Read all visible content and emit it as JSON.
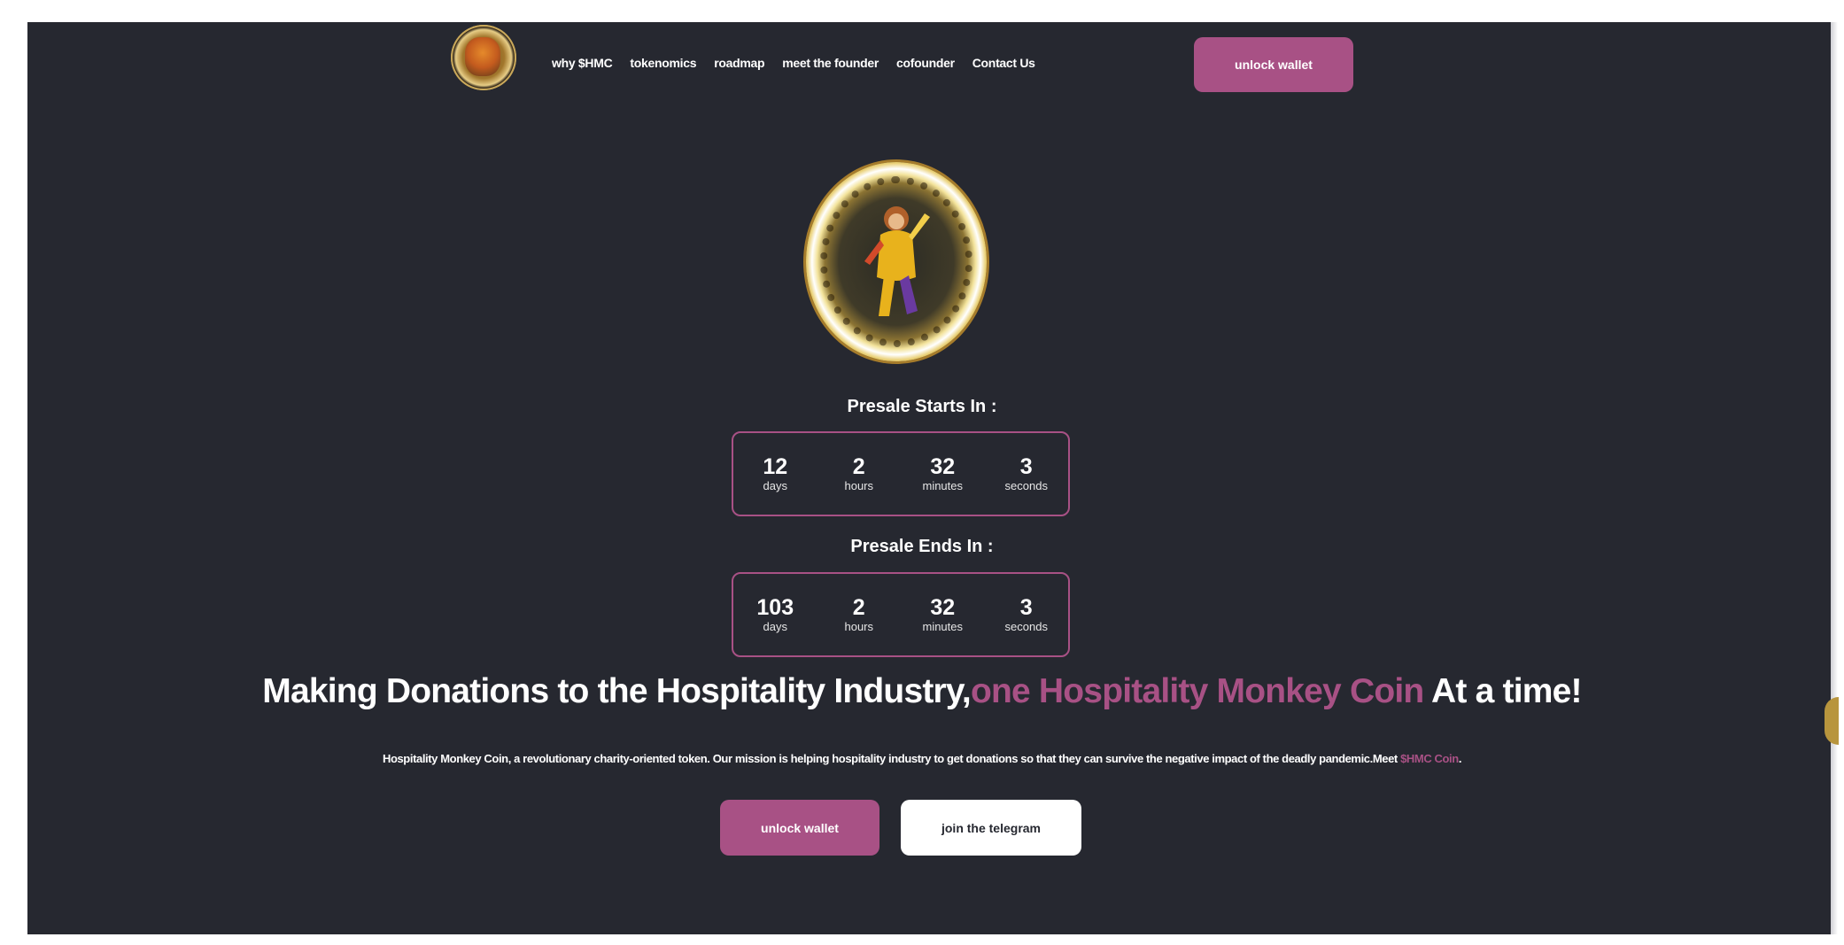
{
  "nav": {
    "items": [
      {
        "label": "why $HMC"
      },
      {
        "label": "tokenomics"
      },
      {
        "label": "roadmap"
      },
      {
        "label": "meet the founder"
      },
      {
        "label": "cofounder"
      },
      {
        "label": "Contact Us"
      }
    ],
    "cta_label": "unlock wallet"
  },
  "presale_start": {
    "label": "Presale Starts In :",
    "units": [
      {
        "value": "12",
        "label": "days"
      },
      {
        "value": "2",
        "label": "hours"
      },
      {
        "value": "32",
        "label": "minutes"
      },
      {
        "value": "3",
        "label": "seconds"
      }
    ]
  },
  "presale_end": {
    "label": "Presale Ends In :",
    "units": [
      {
        "value": "103",
        "label": "days"
      },
      {
        "value": "2",
        "label": "hours"
      },
      {
        "value": "32",
        "label": "minutes"
      },
      {
        "value": "3",
        "label": "seconds"
      }
    ]
  },
  "hero": {
    "headline_part1": "Making Donations to the Hospitality Industry,",
    "headline_accent": "one Hospitality Monkey Coin",
    "headline_part2": " At a time!",
    "description": "Hospitality Monkey Coin, a revolutionary charity-oriented token. Our mission is helping hospitality industry to get donations so that they can survive the negative impact of the deadly pandemic.Meet ",
    "description_accent": "$HMC Coin",
    "description_end": ".",
    "unlock_label": "unlock wallet",
    "telegram_label": "join the telegram"
  },
  "colors": {
    "background": "#262830",
    "accent": "#a85185",
    "text": "#ffffff"
  }
}
